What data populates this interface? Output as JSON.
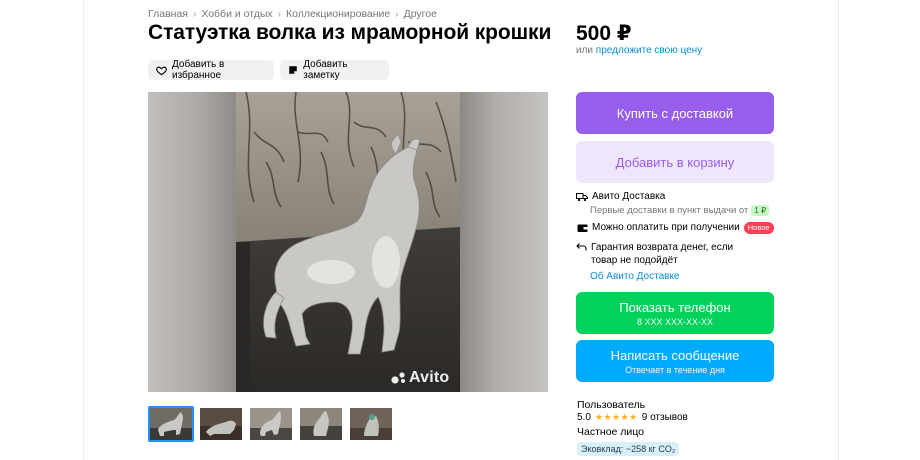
{
  "breadcrumbs": [
    "Главная",
    "Хобби и отдых",
    "Коллекционирование",
    "Другое"
  ],
  "listing": {
    "title": "Статуэтка волка из мраморной крошки",
    "price": "500 ₽",
    "offer_prefix": "или ",
    "offer_link": "предложите свою цену"
  },
  "actions": {
    "favorite": "Добавить в избранное",
    "note": "Добавить заметку"
  },
  "gallery": {
    "watermark": "Avito",
    "thumbnail_count": 5,
    "active_thumbnail": 1
  },
  "purchase": {
    "buy_delivery": "Купить с доставкой",
    "add_cart": "Добавить в корзину"
  },
  "delivery": {
    "title": "Авито Доставка",
    "subtitle": "Первые доставки в пункт выдачи от",
    "subtitle_price": "1 ₽",
    "pay_on_receipt": "Можно оплатить при получении",
    "new_badge": "Новое",
    "guarantee": "Гарантия возврата денег, если товар не подойдёт",
    "about_link": "Об Авито Доставке"
  },
  "contact": {
    "show_phone": "Показать телефон",
    "phone_masked": "8 XXX XXX-XX-XX",
    "write_message": "Написать сообщение",
    "reply_time": "Отвечает в течение дня"
  },
  "seller": {
    "name": "Пользователь",
    "rating": "5.0",
    "stars": "★★★★★",
    "reviews": "9 отзывов",
    "type": "Частное лицо",
    "eco_badge": "Эковклад: ~258 кг CO₂"
  },
  "colors": {
    "purple": "#965eeb",
    "purple_light": "#f0e6fc",
    "green": "#02d15c",
    "blue": "#00aaff",
    "link": "#0a8bd6",
    "badge_red": "#ff3d54"
  }
}
